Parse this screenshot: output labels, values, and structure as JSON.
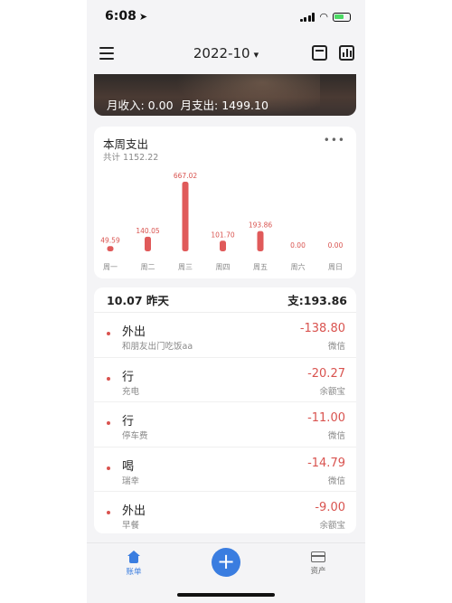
{
  "status_bar": {
    "time": "6:08",
    "location_icon": "location-arrow-icon",
    "icons": [
      "signal-icon",
      "wifi-icon",
      "battery-icon"
    ]
  },
  "nav": {
    "month": "2022-10",
    "icons": [
      "menu-icon",
      "chevron-down-icon",
      "calendar-icon",
      "stats-icon"
    ]
  },
  "banner": {
    "income": "月收入: 0.00",
    "expense": "月支出: 1499.10"
  },
  "week": {
    "title": "本周支出",
    "total": "共计 1152.22",
    "more": "•••",
    "bar_color": "#e05a5a"
  },
  "chart_data": {
    "type": "bar",
    "title": "本周支出",
    "categories": [
      "周一",
      "周二",
      "周三",
      "周四",
      "周五",
      "周六",
      "周日"
    ],
    "values": [
      49.59,
      140.05,
      667.02,
      101.7,
      193.86,
      0.0,
      0.0
    ],
    "value_labels": [
      "49.59",
      "140.05",
      "667.02",
      "101.70",
      "193.86",
      "0.00",
      "0.00"
    ],
    "ylim": [
      0,
      667.02
    ],
    "grid": false,
    "legend": "none"
  },
  "day": {
    "date": "10.07 昨天",
    "total": "支:193.86",
    "transactions": [
      {
        "category": "外出",
        "note": "和朋友出门吃饭aa",
        "amount": "-138.80",
        "account": "微信"
      },
      {
        "category": "行",
        "note": "充电",
        "amount": "-20.27",
        "account": "余额宝"
      },
      {
        "category": "行",
        "note": "停车费",
        "amount": "-11.00",
        "account": "微信"
      },
      {
        "category": "喝",
        "note": "瑞幸",
        "amount": "-14.79",
        "account": "微信"
      },
      {
        "category": "外出",
        "note": "早餐",
        "amount": "-9.00",
        "account": "余额宝"
      }
    ]
  },
  "tab_bar": {
    "ledger_label": "账单",
    "add_label": "+",
    "assets_label": "资产",
    "accent": "#3a7de0"
  }
}
